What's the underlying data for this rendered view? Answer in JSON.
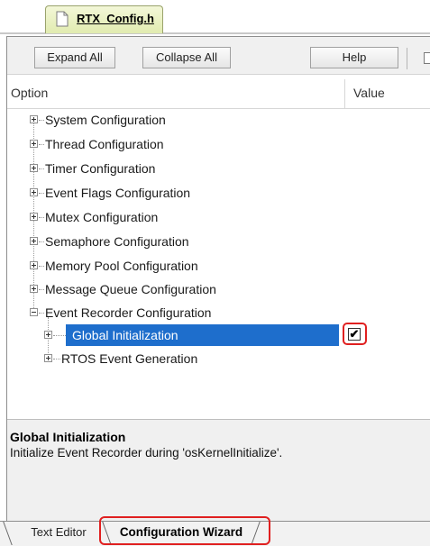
{
  "file_tab": {
    "label": "RTX_Config.h"
  },
  "toolbar": {
    "expand_all": "Expand All",
    "collapse_all": "Collapse All",
    "help": "Help"
  },
  "header": {
    "option": "Option",
    "value": "Value"
  },
  "tree": [
    {
      "label": "System Configuration",
      "state": "collapsed"
    },
    {
      "label": "Thread Configuration",
      "state": "collapsed"
    },
    {
      "label": "Timer Configuration",
      "state": "collapsed"
    },
    {
      "label": "Event Flags Configuration",
      "state": "collapsed"
    },
    {
      "label": "Mutex Configuration",
      "state": "collapsed"
    },
    {
      "label": "Semaphore Configuration",
      "state": "collapsed"
    },
    {
      "label": "Memory Pool Configuration",
      "state": "collapsed"
    },
    {
      "label": "Message Queue Configuration",
      "state": "collapsed"
    },
    {
      "label": "Event Recorder Configuration",
      "state": "expanded",
      "children": [
        {
          "label": "Global Initialization",
          "state": "collapsed",
          "selected": true,
          "value_checked": true
        },
        {
          "label": "RTOS Event Generation",
          "state": "collapsed"
        }
      ]
    }
  ],
  "description": {
    "title": "Global Initialization",
    "text": "Initialize Event Recorder during 'osKernelInitialize'."
  },
  "bottom_tabs": {
    "text_editor": "Text Editor",
    "configuration_wizard": "Configuration Wizard",
    "active": "configuration_wizard"
  },
  "colors": {
    "selection": "#1e6ecc",
    "highlight": "#e02020",
    "file_tab": "#e1ebb0"
  },
  "icons": {
    "file": "file-icon",
    "plus": "plus-expander-icon",
    "minus": "minus-expander-icon",
    "check": "checkmark-icon"
  }
}
